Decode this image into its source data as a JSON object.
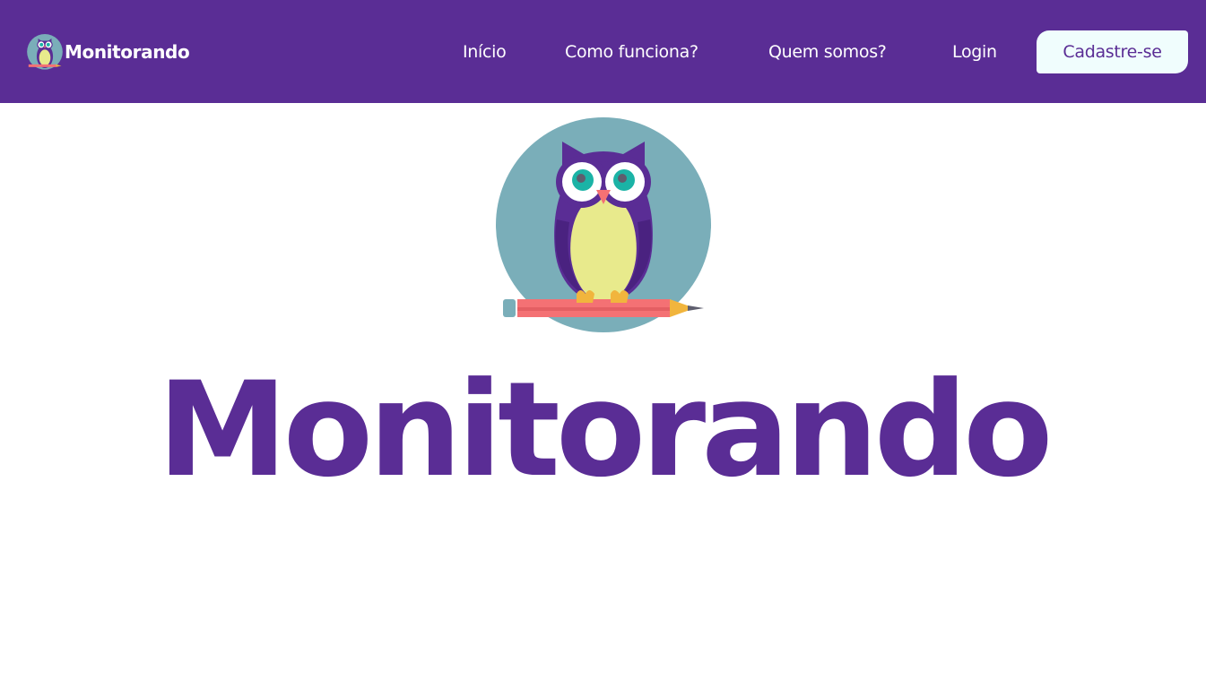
{
  "header": {
    "brand_name": "Monitorando",
    "brand_logo_icon": "owl-logo-icon",
    "nav": {
      "inicio": "Início",
      "como_funciona": "Como funciona?",
      "quem_somos": "Quem somos?",
      "login": "Login",
      "cadastre": "Cadastre-se"
    }
  },
  "hero": {
    "logo_icon": "owl-on-pencil-icon",
    "title": "Monitorando"
  },
  "colors": {
    "brand_purple": "#5a2d95",
    "cta_background": "#f0fdfd",
    "logo_circle": "#7aaeb9",
    "owl_body": "#e8ea8c",
    "pencil": "#f47174"
  }
}
